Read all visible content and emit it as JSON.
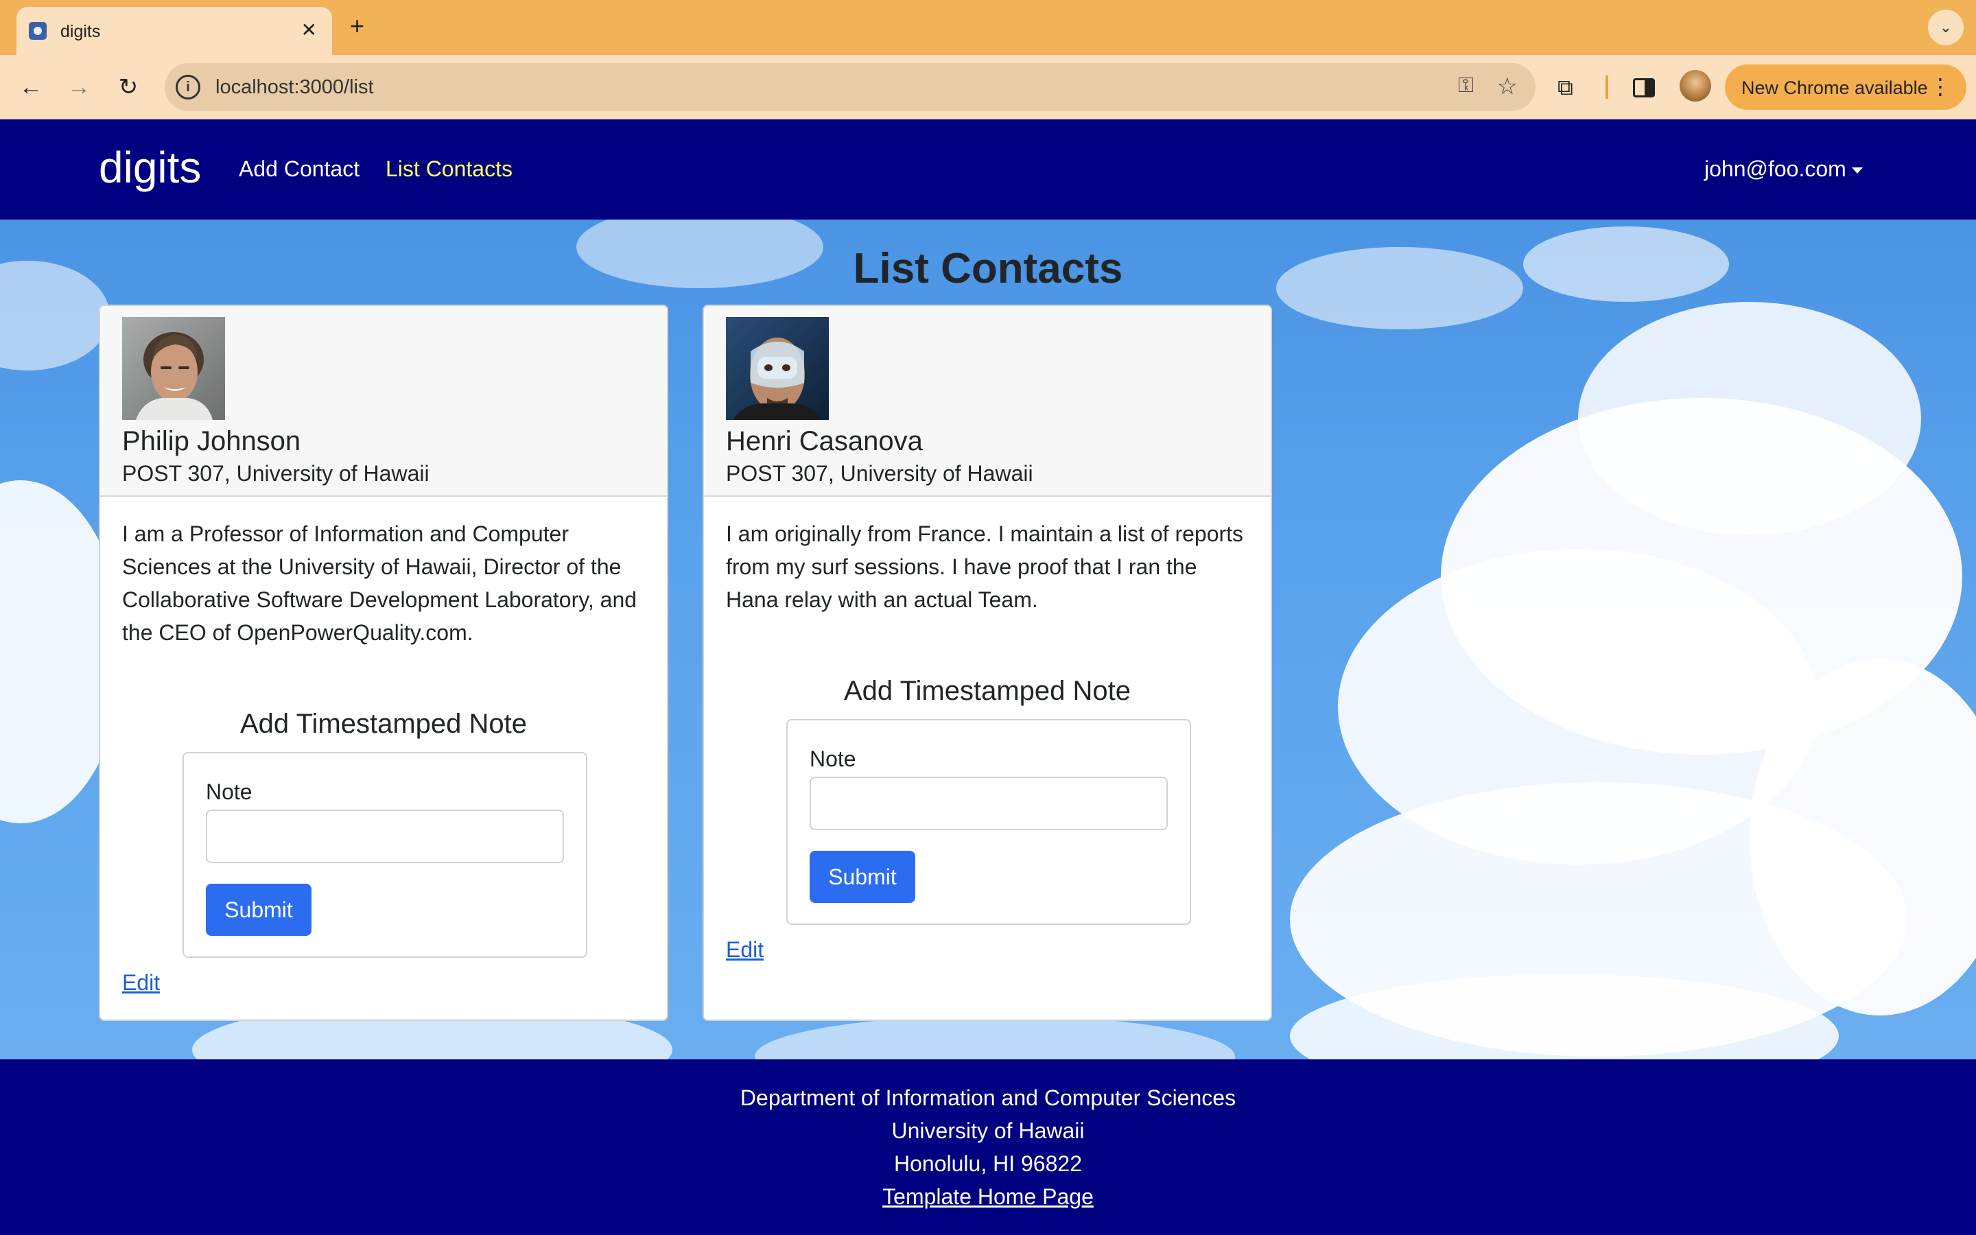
{
  "browser": {
    "tab": {
      "title": "digits",
      "close_glyph": "✕"
    },
    "new_tab_glyph": "+",
    "tab_search_glyph": "⌄",
    "back_glyph": "←",
    "forward_glyph": "→",
    "reload_glyph": "↻",
    "url": "localhost:3000/list",
    "key_glyph": "⚿",
    "star_glyph": "☆",
    "extensions_glyph": "⧉",
    "update_button": "New Chrome available",
    "menu_glyph": "⋮"
  },
  "navbar": {
    "brand": "digits",
    "links": [
      {
        "label": "Add Contact",
        "active": false,
        "color": "#ffffff"
      },
      {
        "label": "List Contacts",
        "active": true,
        "color": "#ffff66"
      }
    ],
    "user": "john@foo.com"
  },
  "page": {
    "title": "List Contacts"
  },
  "contacts": [
    {
      "name": "Philip Johnson",
      "address": "POST 307, University of Hawaii",
      "description": "I am a Professor of Information and Computer Sciences at the University of Hawaii, Director of the Collaborative Software Development Laboratory, and the CEO of OpenPowerQuality.com.",
      "note_title": "Add Timestamped Note",
      "note_label": "Note",
      "note_value": "",
      "submit": "Submit",
      "edit": "Edit"
    },
    {
      "name": "Henri Casanova",
      "address": "POST 307, University of Hawaii",
      "description": "I am originally from France. I maintain a list of reports from my surf sessions. I have proof that I ran the Hana relay with an actual Team.",
      "note_title": "Add Timestamped Note",
      "note_label": "Note",
      "note_value": "",
      "submit": "Submit",
      "edit": "Edit"
    }
  ],
  "footer": {
    "line1": "Department of Information and Computer Sciences",
    "line2": "University of Hawaii",
    "line3": "Honolulu, HI 96822",
    "link": "Template Home Page"
  },
  "colors": {
    "navbar_bg": "#000080",
    "active_link": "#ffff66",
    "primary_button": "#2c6cf0",
    "browser_tabstrip": "#f2b257"
  }
}
